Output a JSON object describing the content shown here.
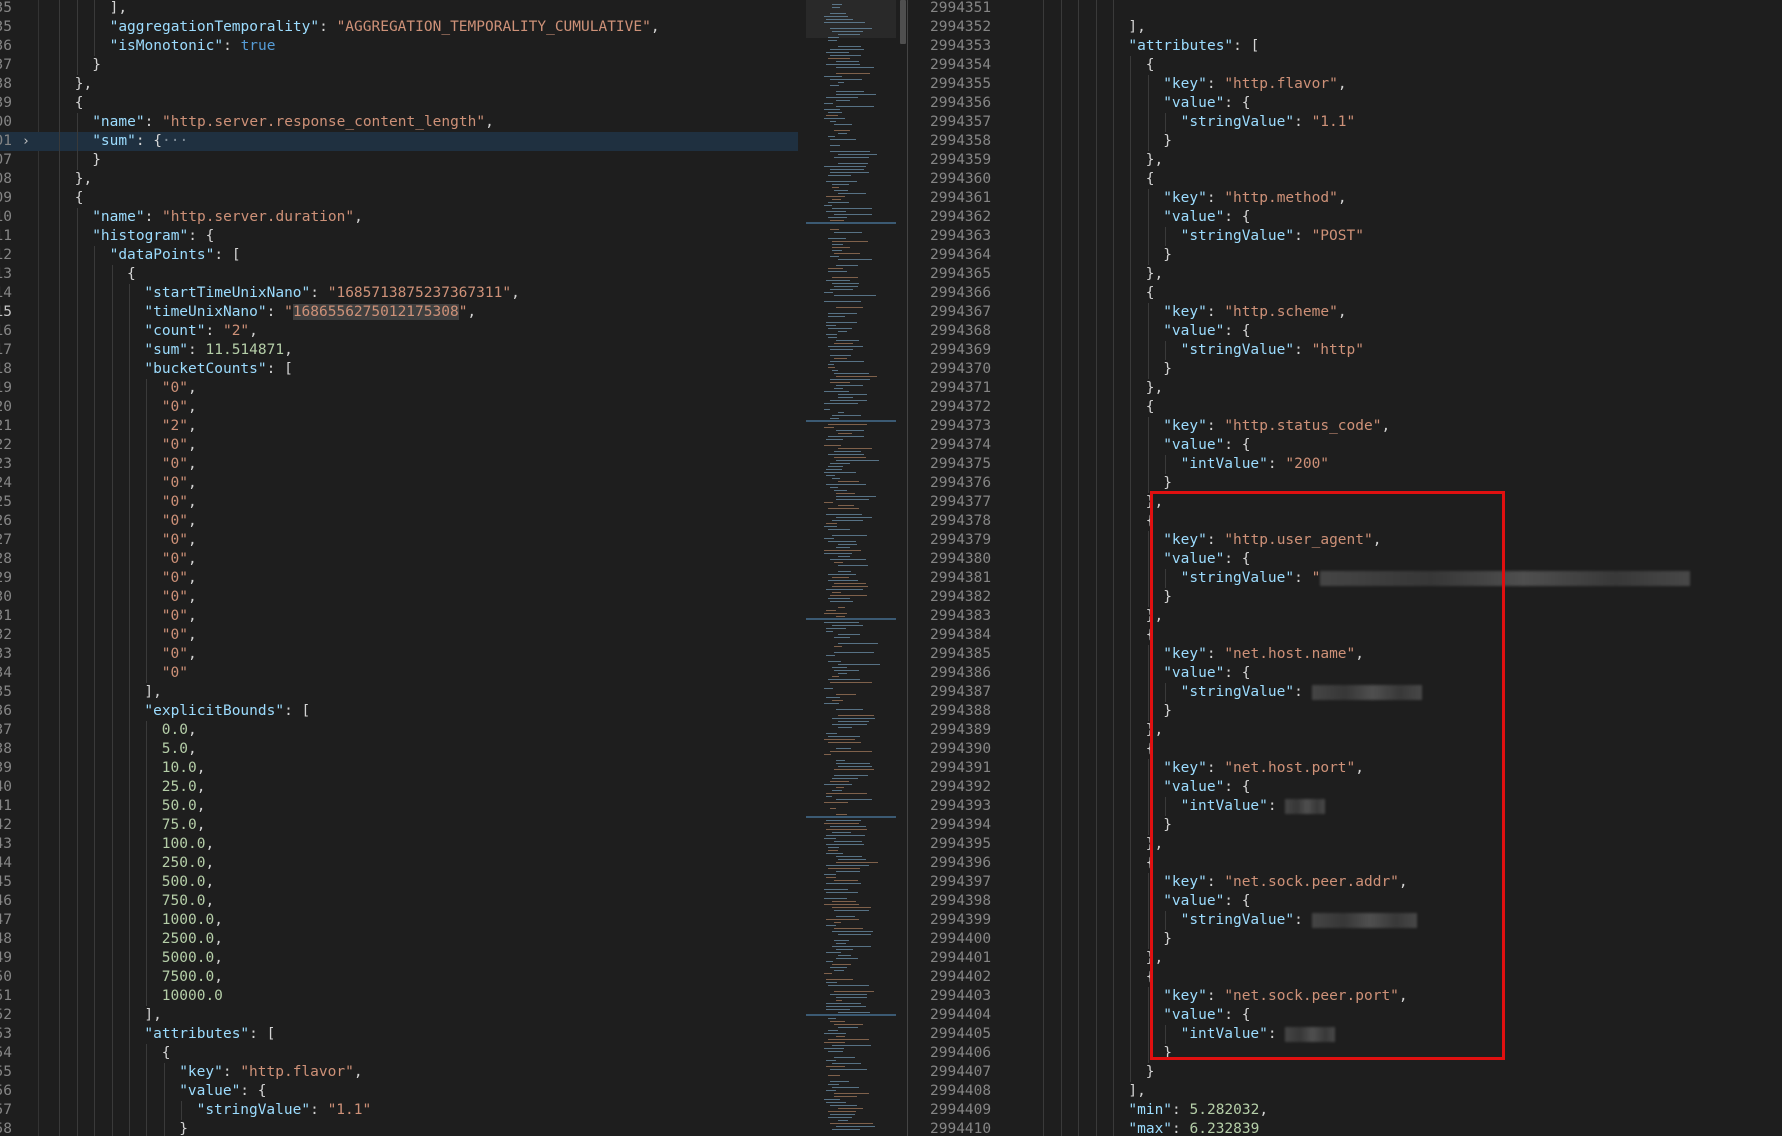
{
  "left_editor": {
    "lines": [
      {
        "n": "35",
        "indent": 8,
        "code": "],"
      },
      {
        "n": "35",
        "indent": 8,
        "code": "\"aggregationTemporality\": \"AGGREGATION_TEMPORALITY_CUMULATIVE\","
      },
      {
        "n": "36",
        "indent": 8,
        "code": "\"isMonotonic\": true"
      },
      {
        "n": "37",
        "indent": 6,
        "code": "}"
      },
      {
        "n": "38",
        "indent": 4,
        "code": "},"
      },
      {
        "n": "39",
        "indent": 4,
        "code": "{"
      },
      {
        "n": "00",
        "indent": 6,
        "code": "\"name\": \"http.server.response_content_length\","
      },
      {
        "n": "01",
        "indent": 6,
        "code": "\"sum\": {···",
        "collapsed": true
      },
      {
        "n": "07",
        "indent": 6,
        "code": "}"
      },
      {
        "n": "08",
        "indent": 4,
        "code": "},"
      },
      {
        "n": "09",
        "indent": 4,
        "code": "{"
      },
      {
        "n": "10",
        "indent": 6,
        "code": "\"name\": \"http.server.duration\","
      },
      {
        "n": "11",
        "indent": 6,
        "code": "\"histogram\": {"
      },
      {
        "n": "12",
        "indent": 8,
        "code": "\"dataPoints\": ["
      },
      {
        "n": "13",
        "indent": 10,
        "code": "{"
      },
      {
        "n": "14",
        "indent": 12,
        "code": "\"startTimeUnixNano\": \"1685713875237367311\","
      },
      {
        "n": "15",
        "indent": 12,
        "code": "\"timeUnixNano\": \"1686556275012175308\",",
        "active": true
      },
      {
        "n": "16",
        "indent": 12,
        "code": "\"count\": \"2\","
      },
      {
        "n": "17",
        "indent": 12,
        "code": "\"sum\": 11.514871,"
      },
      {
        "n": "18",
        "indent": 12,
        "code": "\"bucketCounts\": ["
      },
      {
        "n": "19",
        "indent": 14,
        "code": "\"0\","
      },
      {
        "n": "20",
        "indent": 14,
        "code": "\"0\","
      },
      {
        "n": "21",
        "indent": 14,
        "code": "\"2\","
      },
      {
        "n": "22",
        "indent": 14,
        "code": "\"0\","
      },
      {
        "n": "23",
        "indent": 14,
        "code": "\"0\","
      },
      {
        "n": "24",
        "indent": 14,
        "code": "\"0\","
      },
      {
        "n": "25",
        "indent": 14,
        "code": "\"0\","
      },
      {
        "n": "26",
        "indent": 14,
        "code": "\"0\","
      },
      {
        "n": "27",
        "indent": 14,
        "code": "\"0\","
      },
      {
        "n": "28",
        "indent": 14,
        "code": "\"0\","
      },
      {
        "n": "29",
        "indent": 14,
        "code": "\"0\","
      },
      {
        "n": "30",
        "indent": 14,
        "code": "\"0\","
      },
      {
        "n": "31",
        "indent": 14,
        "code": "\"0\","
      },
      {
        "n": "32",
        "indent": 14,
        "code": "\"0\","
      },
      {
        "n": "33",
        "indent": 14,
        "code": "\"0\","
      },
      {
        "n": "34",
        "indent": 14,
        "code": "\"0\""
      },
      {
        "n": "35",
        "indent": 12,
        "code": "],"
      },
      {
        "n": "36",
        "indent": 12,
        "code": "\"explicitBounds\": ["
      },
      {
        "n": "37",
        "indent": 14,
        "code": "0.0,"
      },
      {
        "n": "38",
        "indent": 14,
        "code": "5.0,"
      },
      {
        "n": "39",
        "indent": 14,
        "code": "10.0,"
      },
      {
        "n": "40",
        "indent": 14,
        "code": "25.0,"
      },
      {
        "n": "41",
        "indent": 14,
        "code": "50.0,"
      },
      {
        "n": "42",
        "indent": 14,
        "code": "75.0,"
      },
      {
        "n": "43",
        "indent": 14,
        "code": "100.0,"
      },
      {
        "n": "44",
        "indent": 14,
        "code": "250.0,"
      },
      {
        "n": "45",
        "indent": 14,
        "code": "500.0,"
      },
      {
        "n": "46",
        "indent": 14,
        "code": "750.0,"
      },
      {
        "n": "47",
        "indent": 14,
        "code": "1000.0,"
      },
      {
        "n": "48",
        "indent": 14,
        "code": "2500.0,"
      },
      {
        "n": "49",
        "indent": 14,
        "code": "5000.0,"
      },
      {
        "n": "50",
        "indent": 14,
        "code": "7500.0,"
      },
      {
        "n": "51",
        "indent": 14,
        "code": "10000.0"
      },
      {
        "n": "52",
        "indent": 12,
        "code": "],"
      },
      {
        "n": "53",
        "indent": 12,
        "code": "\"attributes\": ["
      },
      {
        "n": "54",
        "indent": 14,
        "code": "{"
      },
      {
        "n": "55",
        "indent": 16,
        "code": "\"key\": \"http.flavor\","
      },
      {
        "n": "56",
        "indent": 16,
        "code": "\"value\": {"
      },
      {
        "n": "57",
        "indent": 18,
        "code": "\"stringValue\": \"1.1\""
      },
      {
        "n": "58",
        "indent": 16,
        "code": "}"
      }
    ]
  },
  "right_editor": {
    "lines": [
      {
        "n": "2994351",
        "indent": 12,
        "code": ""
      },
      {
        "n": "2994352",
        "indent": 12,
        "code": "],"
      },
      {
        "n": "2994353",
        "indent": 12,
        "code": "\"attributes\": ["
      },
      {
        "n": "2994354",
        "indent": 14,
        "code": "{"
      },
      {
        "n": "2994355",
        "indent": 16,
        "code": "\"key\": \"http.flavor\","
      },
      {
        "n": "2994356",
        "indent": 16,
        "code": "\"value\": {"
      },
      {
        "n": "2994357",
        "indent": 18,
        "code": "\"stringValue\": \"1.1\""
      },
      {
        "n": "2994358",
        "indent": 16,
        "code": "}"
      },
      {
        "n": "2994359",
        "indent": 14,
        "code": "},"
      },
      {
        "n": "2994360",
        "indent": 14,
        "code": "{"
      },
      {
        "n": "2994361",
        "indent": 16,
        "code": "\"key\": \"http.method\","
      },
      {
        "n": "2994362",
        "indent": 16,
        "code": "\"value\": {"
      },
      {
        "n": "2994363",
        "indent": 18,
        "code": "\"stringValue\": \"POST\""
      },
      {
        "n": "2994364",
        "indent": 16,
        "code": "}"
      },
      {
        "n": "2994365",
        "indent": 14,
        "code": "},"
      },
      {
        "n": "2994366",
        "indent": 14,
        "code": "{"
      },
      {
        "n": "2994367",
        "indent": 16,
        "code": "\"key\": \"http.scheme\","
      },
      {
        "n": "2994368",
        "indent": 16,
        "code": "\"value\": {"
      },
      {
        "n": "2994369",
        "indent": 18,
        "code": "\"stringValue\": \"http\""
      },
      {
        "n": "2994370",
        "indent": 16,
        "code": "}"
      },
      {
        "n": "2994371",
        "indent": 14,
        "code": "},"
      },
      {
        "n": "2994372",
        "indent": 14,
        "code": "{"
      },
      {
        "n": "2994373",
        "indent": 16,
        "code": "\"key\": \"http.status_code\","
      },
      {
        "n": "2994374",
        "indent": 16,
        "code": "\"value\": {"
      },
      {
        "n": "2994375",
        "indent": 18,
        "code": "\"intValue\": \"200\""
      },
      {
        "n": "2994376",
        "indent": 16,
        "code": "}"
      },
      {
        "n": "2994377",
        "indent": 14,
        "code": "},"
      },
      {
        "n": "2994378",
        "indent": 14,
        "code": "{"
      },
      {
        "n": "2994379",
        "indent": 16,
        "code": "\"key\": \"http.user_agent\","
      },
      {
        "n": "2994380",
        "indent": 16,
        "code": "\"value\": {"
      },
      {
        "n": "2994381",
        "indent": 18,
        "code": "\"stringValue\": \"",
        "redacted": true
      },
      {
        "n": "2994382",
        "indent": 16,
        "code": "}"
      },
      {
        "n": "2994383",
        "indent": 14,
        "code": "},"
      },
      {
        "n": "2994384",
        "indent": 14,
        "code": "{"
      },
      {
        "n": "2994385",
        "indent": 16,
        "code": "\"key\": \"net.host.name\","
      },
      {
        "n": "2994386",
        "indent": 16,
        "code": "\"value\": {"
      },
      {
        "n": "2994387",
        "indent": 18,
        "code": "\"stringValue\": ",
        "redacted": true
      },
      {
        "n": "2994388",
        "indent": 16,
        "code": "}"
      },
      {
        "n": "2994389",
        "indent": 14,
        "code": "},"
      },
      {
        "n": "2994390",
        "indent": 14,
        "code": "{"
      },
      {
        "n": "2994391",
        "indent": 16,
        "code": "\"key\": \"net.host.port\","
      },
      {
        "n": "2994392",
        "indent": 16,
        "code": "\"value\": {"
      },
      {
        "n": "2994393",
        "indent": 18,
        "code": "\"intValue\": ",
        "redacted": true
      },
      {
        "n": "2994394",
        "indent": 16,
        "code": "}"
      },
      {
        "n": "2994395",
        "indent": 14,
        "code": "},"
      },
      {
        "n": "2994396",
        "indent": 14,
        "code": "{"
      },
      {
        "n": "2994397",
        "indent": 16,
        "code": "\"key\": \"net.sock.peer.addr\","
      },
      {
        "n": "2994398",
        "indent": 16,
        "code": "\"value\": {"
      },
      {
        "n": "2994399",
        "indent": 18,
        "code": "\"stringValue\": ",
        "redacted": true
      },
      {
        "n": "2994400",
        "indent": 16,
        "code": "}"
      },
      {
        "n": "2994401",
        "indent": 14,
        "code": "},"
      },
      {
        "n": "2994402",
        "indent": 14,
        "code": "{"
      },
      {
        "n": "2994403",
        "indent": 16,
        "code": "\"key\": \"net.sock.peer.port\","
      },
      {
        "n": "2994404",
        "indent": 16,
        "code": "\"value\": {"
      },
      {
        "n": "2994405",
        "indent": 18,
        "code": "\"intValue\": ",
        "redacted": true
      },
      {
        "n": "2994406",
        "indent": 16,
        "code": "}"
      },
      {
        "n": "2994407",
        "indent": 14,
        "code": "}"
      },
      {
        "n": "2994408",
        "indent": 12,
        "code": "],"
      },
      {
        "n": "2994409",
        "indent": 12,
        "code": "\"min\": 5.282032,"
      },
      {
        "n": "2994410",
        "indent": 12,
        "code": "\"max\": 6.232839"
      },
      {
        "n": "2994411",
        "indent": 10,
        "code": ""
      }
    ]
  },
  "colors": {
    "background": "#1e1e1e",
    "key": "#9cdcfe",
    "string": "#ce9178",
    "number": "#b5cea8",
    "keyword": "#569cd6",
    "highlight_box": "#e01010"
  }
}
